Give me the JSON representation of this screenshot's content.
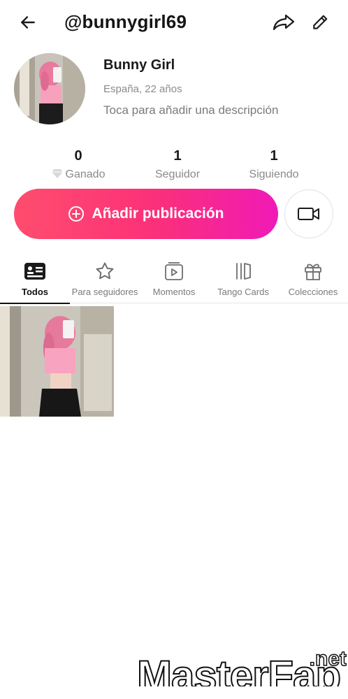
{
  "header": {
    "handle": "@bunnygirl69"
  },
  "profile": {
    "display_name": "Bunny Girl",
    "location_age": "España, 22 años",
    "bio_placeholder": "Toca para añadir una descripción"
  },
  "stats": [
    {
      "value": "0",
      "label": "Ganado"
    },
    {
      "value": "1",
      "label": "Seguidor"
    },
    {
      "value": "1",
      "label": "Siguiendo"
    }
  ],
  "actions": {
    "add_post_label": "Añadir publicación"
  },
  "tabs": [
    {
      "label": "Todos",
      "active": true
    },
    {
      "label": "Para seguidores",
      "active": false
    },
    {
      "label": "Momentos",
      "active": false
    },
    {
      "label": "Tango Cards",
      "active": false
    },
    {
      "label": "Colecciones",
      "active": false
    }
  ],
  "icons": {
    "back": "arrow-left-icon",
    "share": "share-arrow-icon",
    "edit": "pencil-icon",
    "earned": "diamond-icon",
    "add": "plus-circle-icon",
    "video": "video-camera-icon"
  },
  "colors": {
    "accent_start": "#ff4d6d",
    "accent_end": "#f01ab7"
  },
  "watermark": {
    "text": "MasterFap",
    "suffix": ".net"
  }
}
